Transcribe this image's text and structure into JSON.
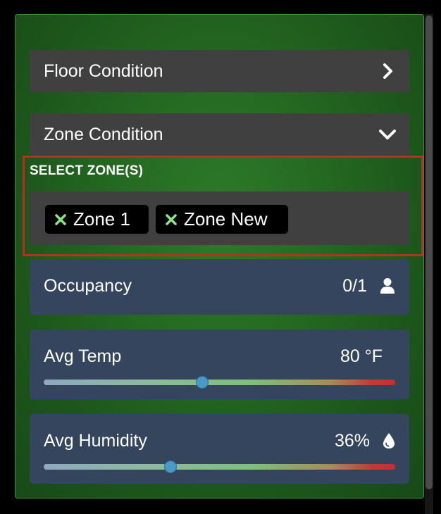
{
  "panel": {
    "floor_condition": {
      "label": "Floor Condition",
      "icon": "chevron-right-icon",
      "expanded": false
    },
    "zone_condition": {
      "label": "Zone Condition",
      "icon": "chevron-down-icon",
      "expanded": true
    },
    "select_zones": {
      "label": "SELECT ZONE(S)",
      "highlight_color": "#b2341f",
      "chips": [
        {
          "label": "Zone 1",
          "icon": "remove-x-icon"
        },
        {
          "label": "Zone New",
          "icon": "remove-x-icon"
        }
      ]
    },
    "occupancy": {
      "label": "Occupancy",
      "value": "0/1",
      "icon": "person-icon"
    },
    "avg_temp": {
      "label": "Avg Temp",
      "value": "80 °F",
      "slider_fraction": 0.45
    },
    "avg_humidity": {
      "label": "Avg Humidity",
      "value": "36%",
      "icon": "water-drop-icon",
      "slider_fraction": 0.36
    }
  },
  "colors": {
    "panel_bg": "#256a22",
    "accordion_bg": "#404040",
    "card_bg": "#34455d",
    "chip_bg": "#000000",
    "chip_x": "#8be58b",
    "slider_thumb": "#4a9ac8"
  }
}
